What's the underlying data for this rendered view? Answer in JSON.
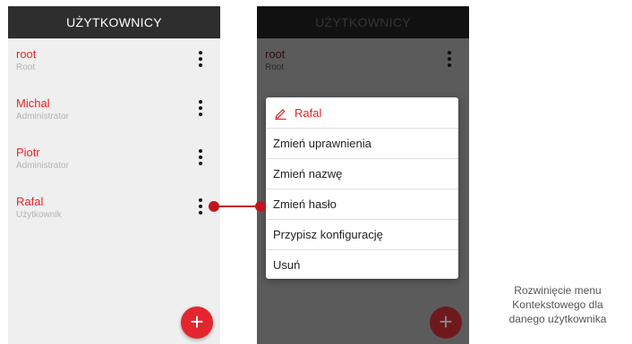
{
  "appbar": {
    "title": "UŻYTKOWNICY"
  },
  "users": [
    {
      "name": "root",
      "role": "Root"
    },
    {
      "name": "Michal",
      "role": "Administrator"
    },
    {
      "name": "Piotr",
      "role": "Administrator"
    },
    {
      "name": "Rafal",
      "role": "Użytkownik"
    }
  ],
  "fab": {
    "label": "+"
  },
  "context_menu": {
    "header": "Rafal",
    "items": [
      "Zmień uprawnienia",
      "Zmień nazwę",
      "Zmień hasło",
      "Przypisz konfigurację",
      "Usuń"
    ]
  },
  "caption": [
    "Rozwinięcie menu",
    "Kontekstowego dla",
    "danego użytkownika"
  ],
  "colors": {
    "accent": "#e3262d",
    "appbar": "#2e2e2e",
    "background": "#efefef"
  },
  "icons": {
    "menu": "more-vertical-icon",
    "edit": "pencil-icon",
    "add": "plus-icon"
  }
}
